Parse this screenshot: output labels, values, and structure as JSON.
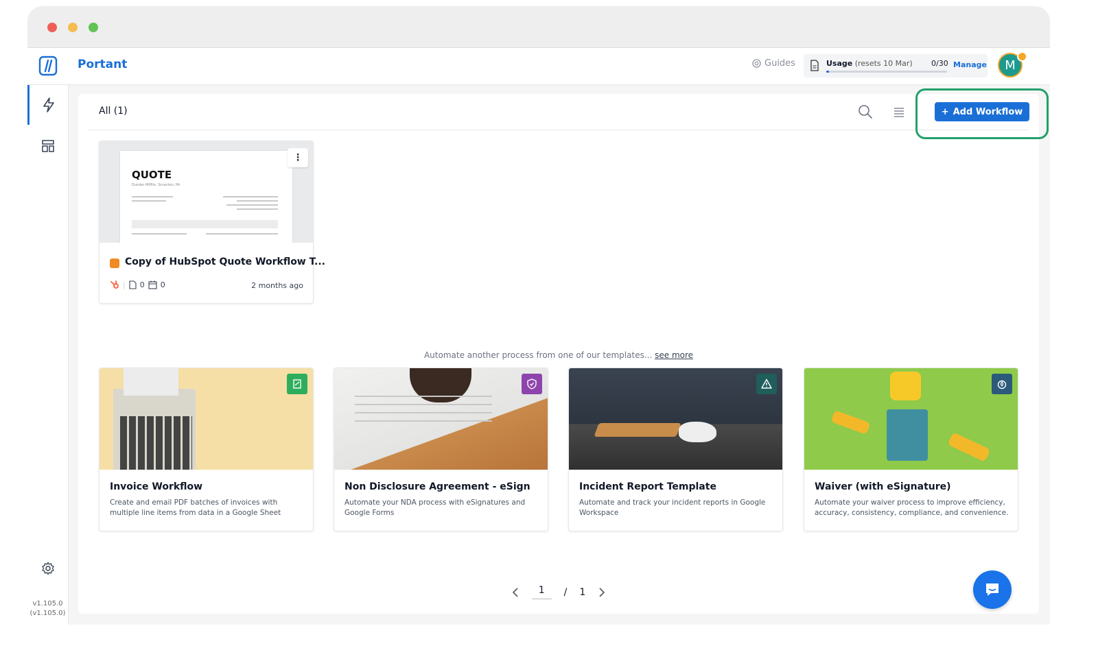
{
  "app": {
    "brand": "Portant",
    "version": "v1.105.0",
    "version_sub": "(v1.105.0)"
  },
  "header": {
    "guides_label": "Guides",
    "usage_label": "Usage",
    "usage_reset": "(resets 10 Mar)",
    "usage_count": "0/30",
    "usage_fraction": 0,
    "manage_label": "Manage",
    "avatar_initial": "M"
  },
  "toolbar": {
    "tab_all": "All (1)",
    "add_workflow_label": "Add Workflow"
  },
  "workflow_card": {
    "thumb_title": "QUOTE",
    "thumb_subtitle": "Dunder Mifflin, Scranton, PA",
    "title": "Copy of HubSpot Quote Workflow T...",
    "docs_count": "0",
    "schedules_count": "0",
    "updated": "2 months ago"
  },
  "templates": {
    "caption": "Automate another process from one of our templates...",
    "see_more": "see more",
    "items": [
      {
        "title": "Invoice Workflow",
        "description": "Create and email PDF batches of invoices with multiple line items from data in a Google Sheet",
        "badge_color": "#2eae5c"
      },
      {
        "title": "Non Disclosure Agreement - eSign",
        "description": "Automate your NDA process with eSignatures and Google Forms",
        "badge_color": "#8e44ad"
      },
      {
        "title": "Incident Report Template",
        "description": "Automate and track your incident reports in Google Workspace",
        "badge_color": "#1f5e5b"
      },
      {
        "title": "Waiver (with eSignature)",
        "description": "Automate your waiver process to improve efficiency, accuracy, consistency, compliance, and convenience.",
        "badge_color": "#2c5a7a"
      }
    ]
  },
  "pagination": {
    "current": "1",
    "separator": "/",
    "total": "1"
  },
  "colors": {
    "accent": "#1a6fd6",
    "highlight": "#22a06b"
  }
}
